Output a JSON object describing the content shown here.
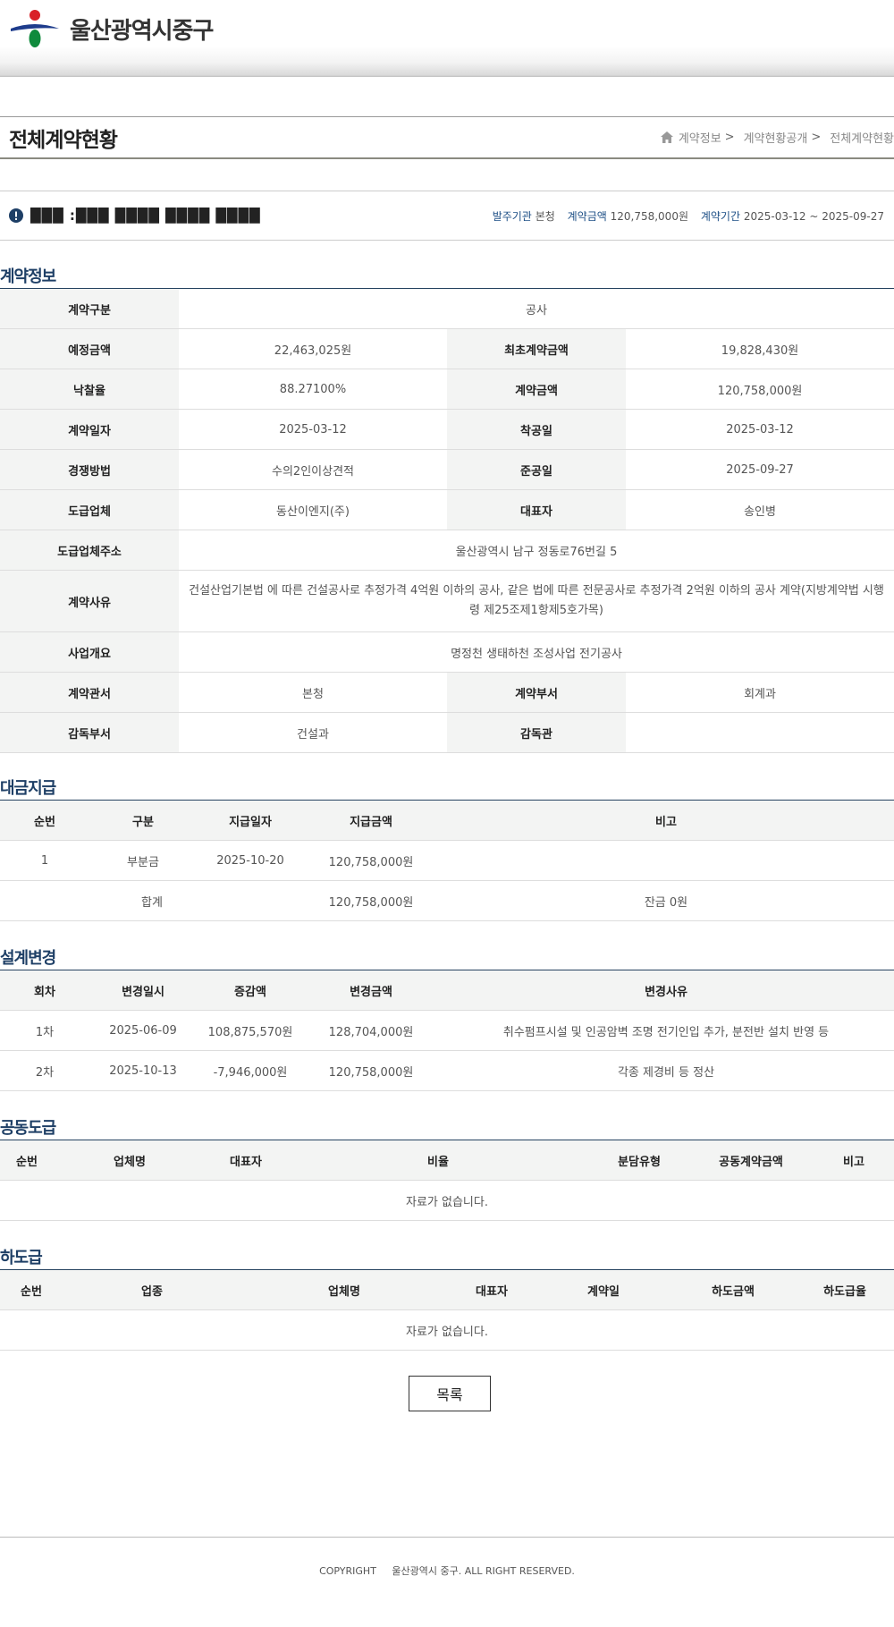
{
  "header": {
    "org_name": "울산광역시중구"
  },
  "page": {
    "title": "전체계약현황"
  },
  "breadcrumb": {
    "items": [
      "계약정보",
      "계약현황공개",
      "전체계약현황"
    ],
    "separator": ">"
  },
  "summary": {
    "title": "███ :███ ████ ████ ████",
    "org_label": "발주기관",
    "org_value": "본청",
    "amount_label": "계약금액",
    "amount_value": "120,758,000원",
    "period_label": "계약기간",
    "period_value": "2025-03-12 ~ 2025-09-27"
  },
  "contract": {
    "heading": "계약정보",
    "type_label": "계약구분",
    "type_value": "공사",
    "est_label": "예정금액",
    "est_value": "22,463,025원",
    "init_label": "최초계약금액",
    "init_value": "19,828,430원",
    "rate_label": "낙찰율",
    "rate_value": "88.27100%",
    "amt_label": "계약금액",
    "amt_value": "120,758,000원",
    "date_label": "계약일자",
    "date_value": "2025-03-12",
    "start_label": "착공일",
    "start_value": "2025-03-12",
    "method_label": "경쟁방법",
    "method_value": "수의2인이상견적",
    "end_label": "준공일",
    "end_value": "2025-09-27",
    "company_label": "도급업체",
    "company_value": "동산이엔지(주)",
    "ceo_label": "대표자",
    "ceo_value": "송인병",
    "addr_label": "도급업체주소",
    "addr_value": "울산광역시 남구 정동로76번길 5",
    "reason_label": "계약사유",
    "reason_value": "건설산업기본법    에 따른 건설공사로 추정가격 4억원 이하의 공사, 같은 법에 따른 전문공사로 추정가격 2억원 이하의 공사 계약(지방계약법 시행령 제25조제1항제5호가목)",
    "overview_label": "사업개요",
    "overview_value": "명정천 생태하천 조성사업 전기공사",
    "office_label": "계약관서",
    "office_value": "본청",
    "dept_label": "계약부서",
    "dept_value": "회계과",
    "sup_dept_label": "감독부서",
    "sup_dept_value": "건설과",
    "supervisor_label": "감독관",
    "supervisor_value": ""
  },
  "payment": {
    "heading": "대금지급",
    "headers": [
      "순번",
      "구분",
      "지급일자",
      "지급금액",
      "비고"
    ],
    "rows": [
      [
        "1",
        "부분금",
        "2025-10-20",
        "120,758,000원",
        ""
      ]
    ],
    "total": {
      "label": "합계",
      "amount": "120,758,000원",
      "note": "잔금 0원"
    }
  },
  "design": {
    "heading": "설계변경",
    "headers": [
      "회차",
      "변경일시",
      "증감액",
      "변경금액",
      "변경사유"
    ],
    "rows": [
      [
        "1차",
        "2025-06-09",
        "108,875,570원",
        "128,704,000원",
        "취수펌프시설 및 인공암벽 조명 전기인입 추가, 분전반 설치 반영 등"
      ],
      [
        "2차",
        "2025-10-13",
        "-7,946,000원",
        "120,758,000원",
        "각종 제경비 등 정산"
      ]
    ]
  },
  "joint": {
    "heading": "공동도급",
    "headers": [
      "순번",
      "업체명",
      "대표자",
      "비율",
      "분담유형",
      "공동계약금액",
      "비고"
    ],
    "empty": "자료가 없습니다."
  },
  "sub": {
    "heading": "하도급",
    "headers": [
      "순번",
      "업종",
      "업체명",
      "대표자",
      "계약일",
      "하도금액",
      "하도급율"
    ],
    "empty": "자료가 없습니다."
  },
  "list_button": "목록",
  "footer": {
    "copyright": "COPYRIGHT     울산광역시 중구. ALL RIGHT RESERVED."
  },
  "colors": {
    "heading": "#1e3f66",
    "label_bg": "#f3f4f3",
    "accent": "#1d4f86"
  }
}
